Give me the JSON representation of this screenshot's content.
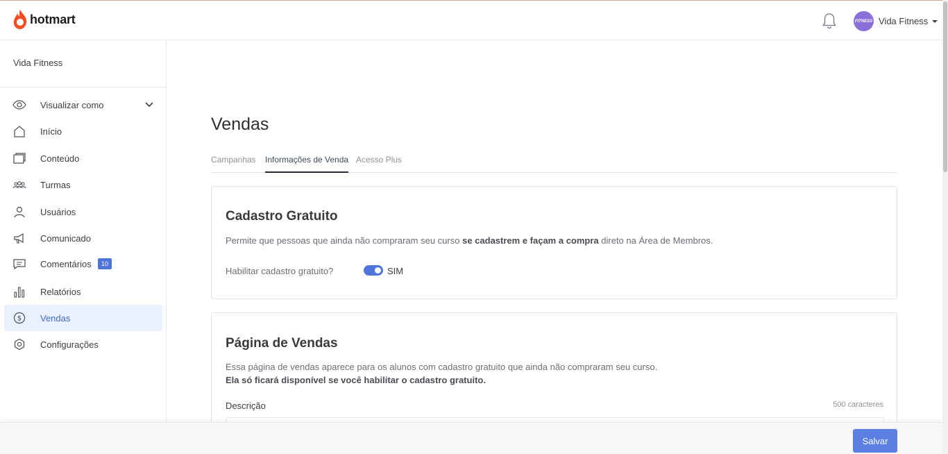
{
  "brand": {
    "name": "hotmart",
    "color": "#f04e23"
  },
  "header": {
    "user_name": "Vida Fitness",
    "avatar_text": "FITNESS"
  },
  "sidebar": {
    "school_name": "Vida Fitness",
    "items": [
      {
        "label": "Visualizar como",
        "icon": "eye-icon"
      },
      {
        "label": "Início",
        "icon": "home-icon"
      },
      {
        "label": "Conteúdo",
        "icon": "folder-icon"
      },
      {
        "label": "Turmas",
        "icon": "people-icon"
      },
      {
        "label": "Usuários",
        "icon": "user-icon"
      },
      {
        "label": "Comunicado",
        "icon": "megaphone-icon"
      },
      {
        "label": "Comentários",
        "icon": "comment-icon",
        "badge": "10"
      },
      {
        "label": "Relatórios",
        "icon": "bar-chart-icon"
      },
      {
        "label": "Vendas",
        "icon": "dollar-icon",
        "active": true
      },
      {
        "label": "Configurações",
        "icon": "gear-icon"
      }
    ]
  },
  "main": {
    "title": "Vendas",
    "tabs": [
      {
        "label": "Campanhas"
      },
      {
        "label": "Informações de Venda",
        "active": true
      },
      {
        "label": "Acesso Plus"
      }
    ],
    "free_signup": {
      "title": "Cadastro Gratuito",
      "desc_prefix": "Permite que pessoas que ainda não compraram seu curso ",
      "desc_bold": "se cadastrem e façam a compra",
      "desc_suffix": " direto na Área de Membros.",
      "toggle_label": "Habilitar cadastro gratuito?",
      "toggle_value": "SIM",
      "toggle_on": true
    },
    "sales_page": {
      "title": "Página de Vendas",
      "desc_line1": "Essa página de vendas aparece para os alunos com cadastro gratuito que ainda não compraram seu curso.",
      "desc_line2": "Ela só ficará disponível se você habilitar o cadastro gratuito.",
      "description_label": "Descrição",
      "char_limit": "500 caracteres"
    }
  },
  "footer": {
    "save_label": "Salvar"
  },
  "colors": {
    "accent": "#5b7fe3",
    "active_bg": "#e9f0ff"
  }
}
